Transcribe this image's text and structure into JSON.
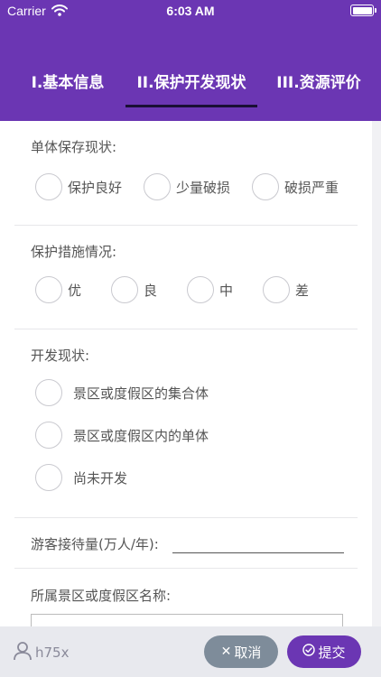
{
  "status_bar": {
    "carrier": "Carrier",
    "time": "6:03 AM"
  },
  "tabs": [
    {
      "label": "I.基本信息"
    },
    {
      "label": "II.保护开发现状"
    },
    {
      "label": "III.资源评价"
    }
  ],
  "active_tab": "II.保护开发现状",
  "form": {
    "preservation": {
      "title": "单体保存现状:",
      "options": [
        "保护良好",
        "少量破损",
        "破损严重"
      ]
    },
    "protection": {
      "title": "保护措施情况:",
      "options": [
        "优",
        "良",
        "中",
        "差"
      ]
    },
    "development": {
      "title": "开发现状:",
      "options": [
        "景区或度假区的集合体",
        "景区或度假区内的单体",
        "尚未开发"
      ]
    },
    "visitors": {
      "label": "游客接待量(万人/年):",
      "value": ""
    },
    "area_name": {
      "label": "所属景区或度假区名称:",
      "value": ""
    }
  },
  "bottom_bar": {
    "user": "h75x",
    "cancel_label": "取消",
    "submit_label": "提交"
  },
  "colors": {
    "accent": "#6b36b3",
    "cancel": "#7e8c9a",
    "bottom_bg": "#e8e9ee"
  }
}
